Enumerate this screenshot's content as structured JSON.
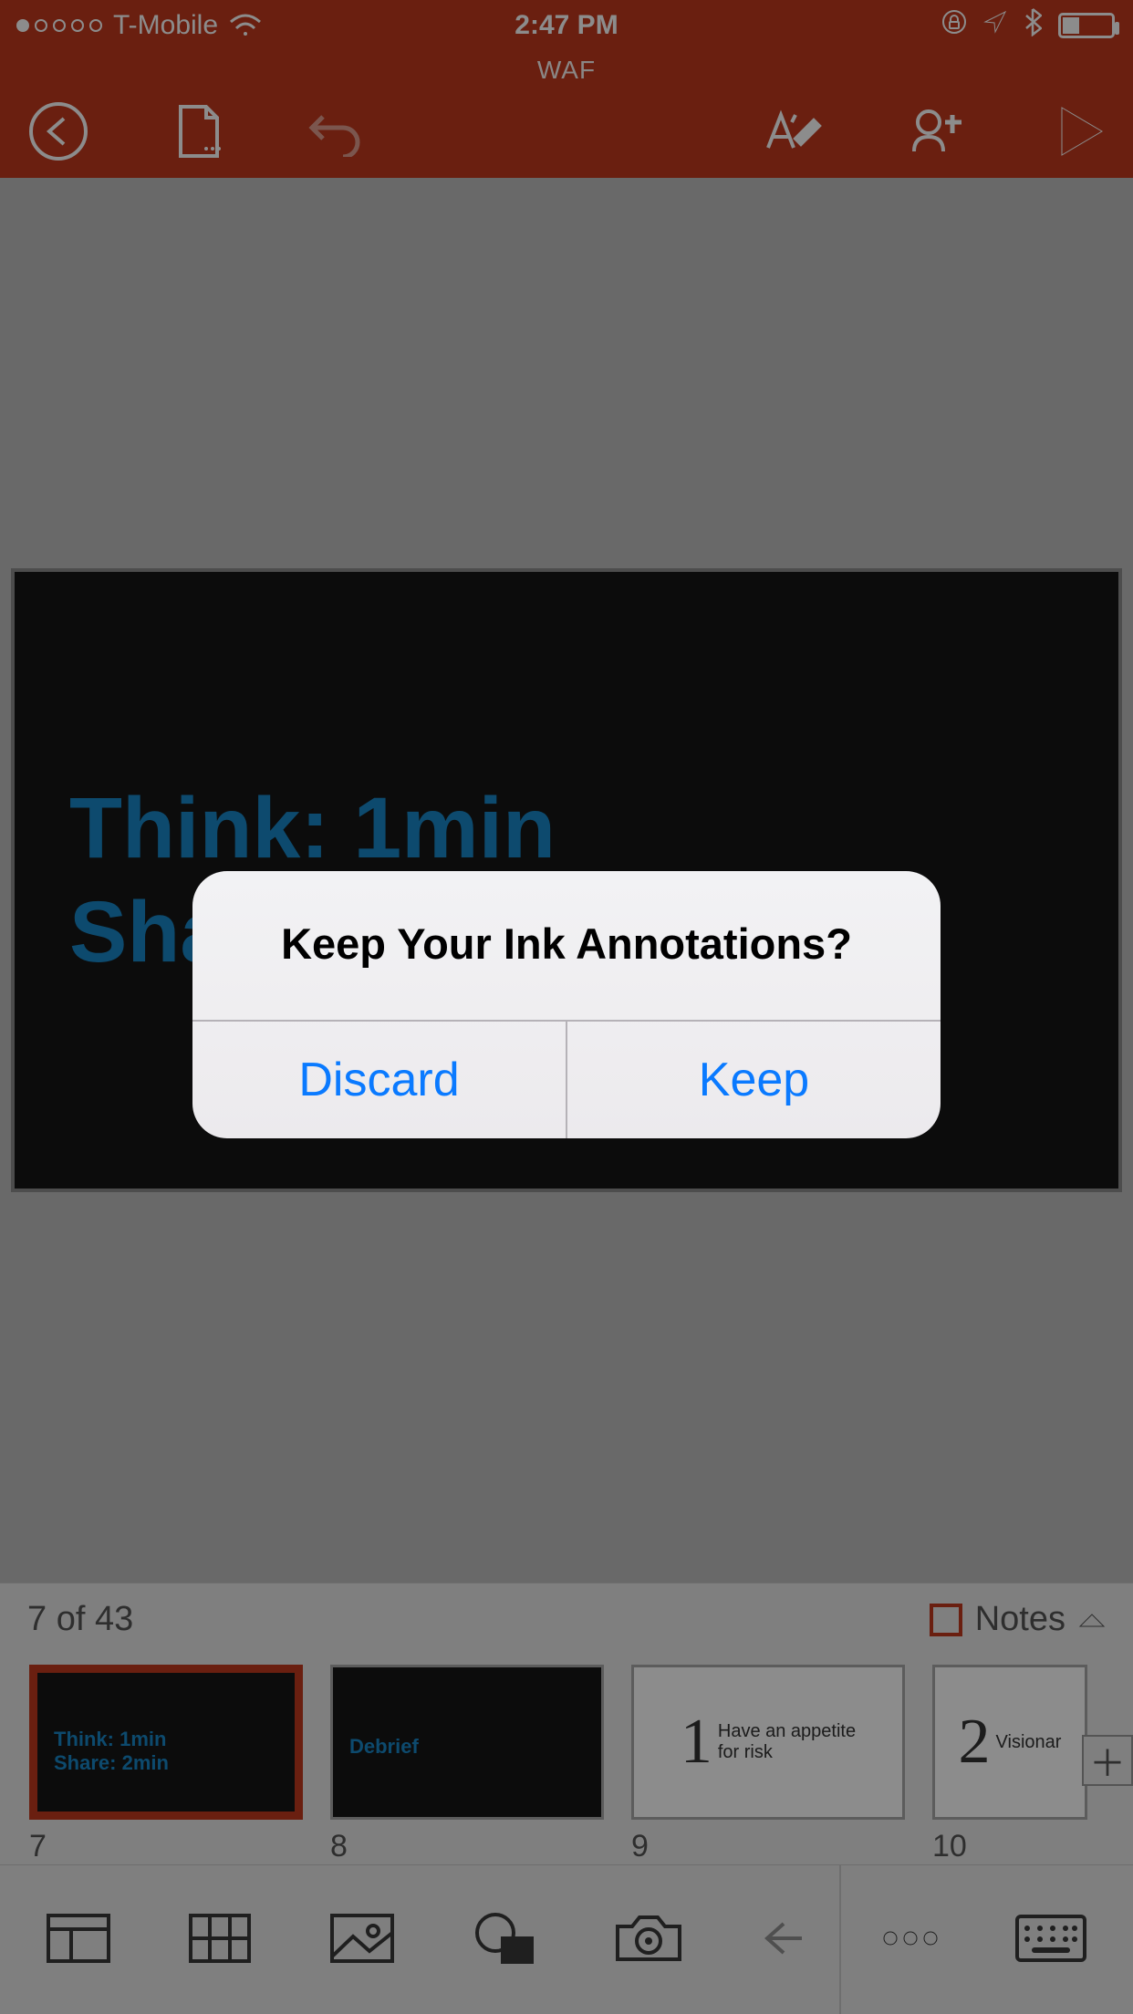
{
  "statusbar": {
    "carrier": "T-Mobile",
    "time": "2:47 PM"
  },
  "header": {
    "title": "WAF"
  },
  "slide": {
    "line1": "Think: 1min",
    "line2": "Share: 2min"
  },
  "strip": {
    "counter": "7 of 43",
    "notes_label": "Notes"
  },
  "thumbs": [
    {
      "num": "7",
      "type": "dark",
      "line1": "Think: 1min",
      "line2": "Share: 2min",
      "selected": true
    },
    {
      "num": "8",
      "type": "dark",
      "line1": "Debrief",
      "line2": ""
    },
    {
      "num": "9",
      "type": "light",
      "big": "1",
      "sub1": "Have an appetite",
      "sub2": "for risk"
    },
    {
      "num": "10",
      "type": "light",
      "big": "2",
      "sub1": "Visionar",
      "sub2": ""
    }
  ],
  "alert": {
    "title": "Keep Your Ink Annotations?",
    "discard": "Discard",
    "keep": "Keep"
  }
}
